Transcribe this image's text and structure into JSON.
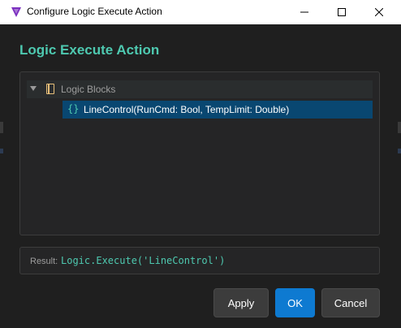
{
  "window": {
    "title": "Configure Logic Execute Action",
    "controls": {
      "minimize_icon": "minimize-icon",
      "maximize_icon": "maximize-icon",
      "close_icon": "close-icon"
    }
  },
  "dialog": {
    "heading": "Logic Execute Action",
    "tree": {
      "root": {
        "label": "Logic Blocks",
        "icon": "notebook-icon",
        "expanded": true
      },
      "children": [
        {
          "icon_text": "{}",
          "label": "LineControl(RunCmd: Bool, TempLimit: Double)",
          "selected": true
        }
      ]
    },
    "result": {
      "label": "Result:",
      "value": "Logic.Execute('LineControl')"
    },
    "buttons": {
      "apply": "Apply",
      "ok": "OK",
      "cancel": "Cancel"
    }
  },
  "colors": {
    "accent": "#4ec9b0",
    "primary_button": "#0e7ad1",
    "selection": "#094771",
    "background": "#1f1f1f"
  }
}
